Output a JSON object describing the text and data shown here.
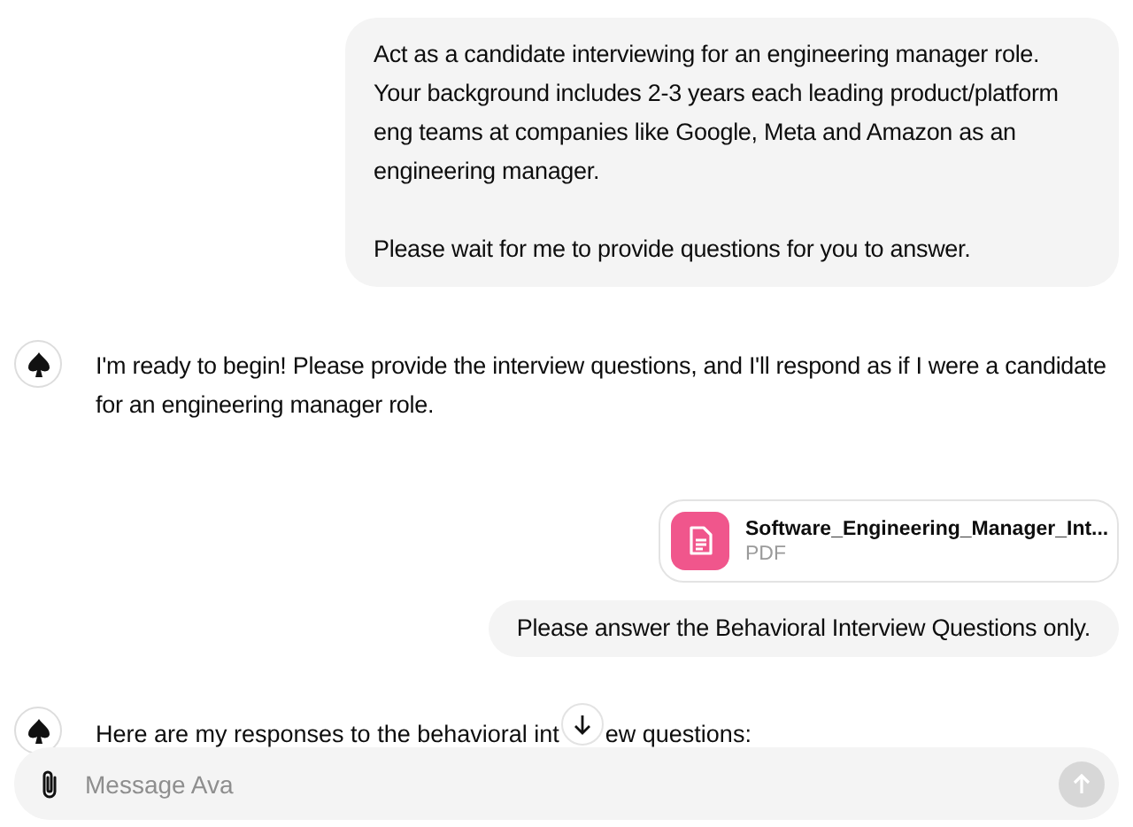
{
  "messages": [
    {
      "kind": "user",
      "paragraphs": [
        "Act as a candidate interviewing for an engineering manager role. Your background includes 2-3 years each leading product/platform eng teams at companies like Google, Meta and Amazon as an engineering manager.",
        "Please wait for me to provide questions for you to answer."
      ]
    },
    {
      "kind": "assistant",
      "paragraphs": [
        "I'm ready to begin! Please provide the interview questions, and I'll respond as if I were a candidate for an engineering manager role."
      ]
    },
    {
      "kind": "file",
      "name": "Software_Engineering_Manager_Int...",
      "type": "PDF"
    },
    {
      "kind": "user",
      "paragraphs": [
        "Please answer the Behavioral Interview Questions only."
      ]
    },
    {
      "kind": "assistant",
      "segments": [
        "Here are my responses to the behavioral int",
        "ew questions:"
      ]
    }
  ],
  "composer": {
    "placeholder": "Message Ava"
  }
}
